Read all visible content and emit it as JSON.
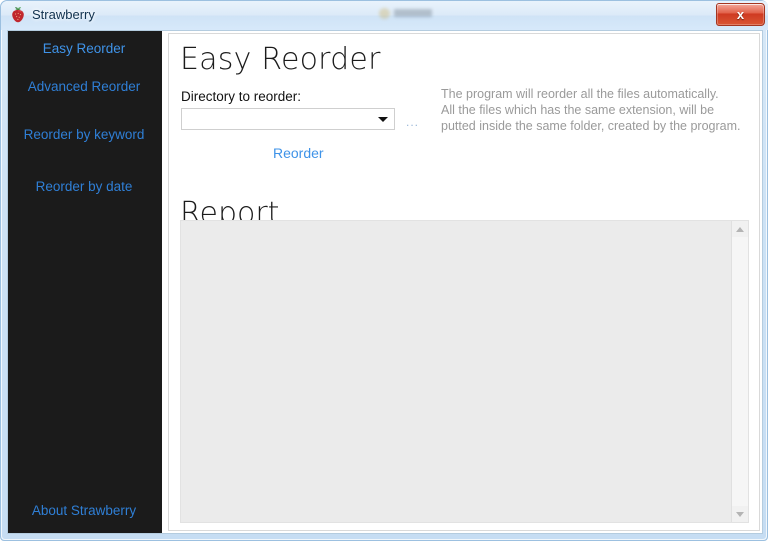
{
  "window": {
    "title": "Strawberry",
    "icon": "strawberry-icon",
    "close_label": "x",
    "accent_blue": "#3f93e8",
    "sidebar_bg": "#1b1b1b",
    "close_red": "#cf3a22"
  },
  "sidebar": {
    "items": [
      {
        "label": "Easy Reorder",
        "active": true
      },
      {
        "label": "Advanced Reorder",
        "active": false
      },
      {
        "label": "Reorder by keyword",
        "active": false
      },
      {
        "label": "Reorder by date",
        "active": false
      }
    ],
    "about_label": "About Strawberry"
  },
  "main": {
    "page_title": "Easy Reorder",
    "directory_label": "Directory to reorder:",
    "directory_value": "",
    "directory_placeholder": "",
    "browse_label": "...",
    "reorder_label": "Reorder",
    "hint_lines": [
      "The program will reorder all the files automatically.",
      "All the files which has the same extension, will be",
      "putted inside the same folder, created by the program."
    ],
    "report_title": "Report",
    "report_text": ""
  }
}
